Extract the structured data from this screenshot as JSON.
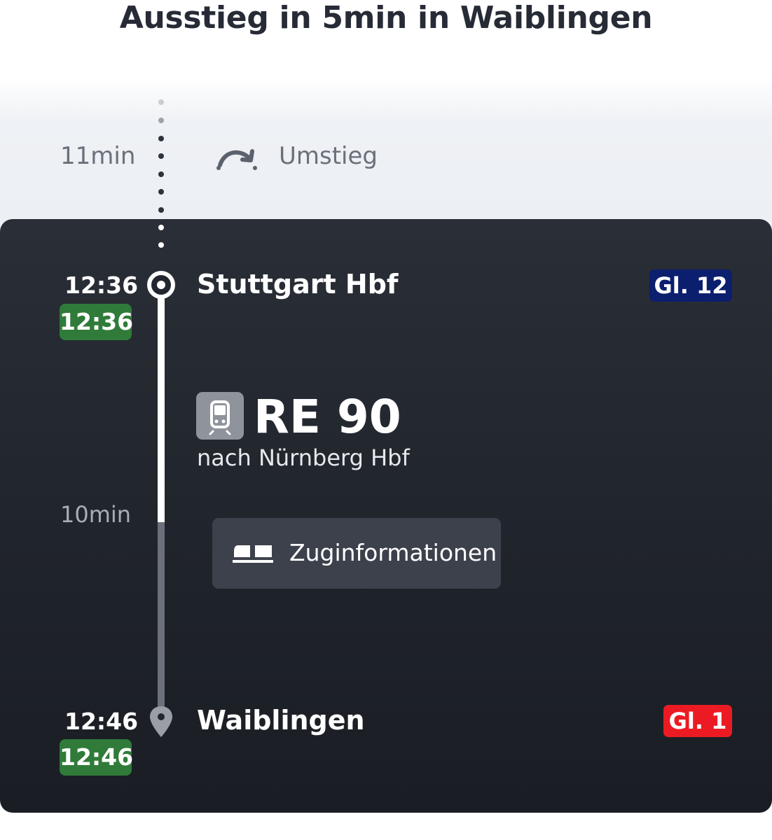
{
  "header": {
    "title": "Ausstieg in 5min in Waiblingen"
  },
  "transfer": {
    "duration": "11min",
    "label": "Umstieg",
    "icon": "transfer-arrow-icon"
  },
  "origin": {
    "scheduled_time": "12:36",
    "live_time": "12:36",
    "station": "Stuttgart Hbf",
    "platform": "Gl. 12",
    "platform_color": "#0c1e6e"
  },
  "train": {
    "icon": "train-icon",
    "line": "RE 90",
    "direction": "nach Nürnberg Hbf",
    "duration": "10min",
    "info_button_label": "Zuginformationen",
    "info_icon": "train-coach-icon"
  },
  "destination": {
    "scheduled_time": "12:46",
    "live_time": "12:46",
    "station": "Waiblingen",
    "platform": "Gl. 1",
    "platform_color": "#ec1b23"
  },
  "colors": {
    "live_badge": "#307b3a",
    "card_background": "#22262e",
    "text_muted": "#6a707b"
  }
}
